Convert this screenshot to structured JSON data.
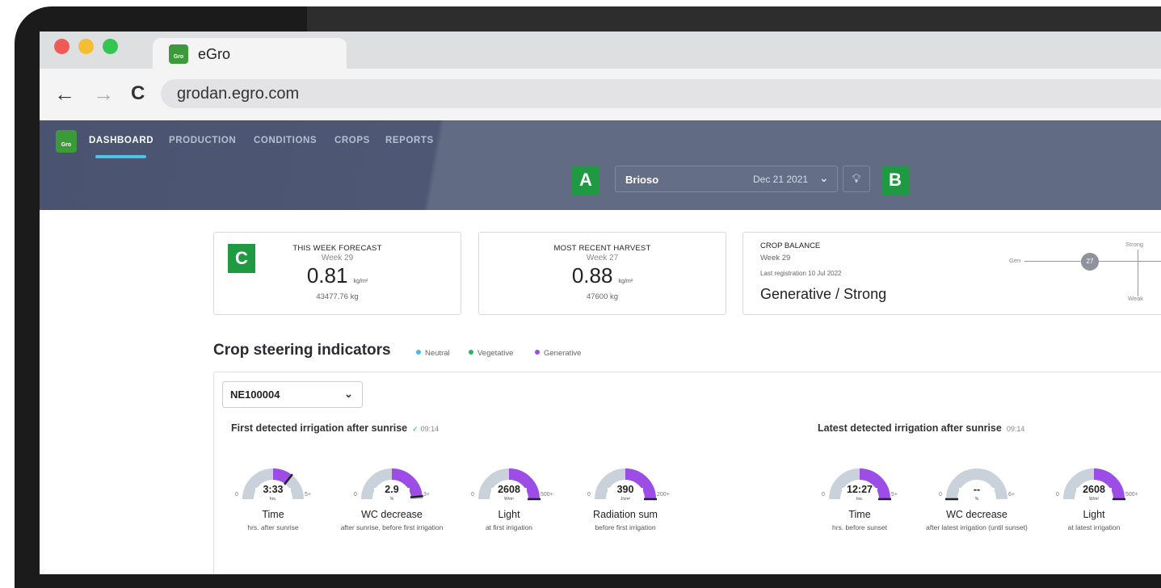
{
  "browser": {
    "tab_title": "eGro",
    "url": "grodan.egro.com",
    "back_glyph": "←",
    "forward_glyph": "→",
    "reload_glyph": "C",
    "favicon_text": "Gro",
    "dot_colors": [
      "#ee5b55",
      "#f5bd32",
      "#35c552"
    ]
  },
  "app": {
    "logo_text": "Gro",
    "nav": [
      "DASHBOARD",
      "PRODUCTION",
      "CONDITIONS",
      "CROPS",
      "REPORTS"
    ],
    "active_nav": "DASHBOARD",
    "location": "Brioso",
    "date": "Dec 21 2021",
    "markers": {
      "a": "A",
      "b": "B",
      "c": "C"
    },
    "accent": "#4cc3ea"
  },
  "cards": {
    "forecast": {
      "caption": "THIS WEEK FORECAST",
      "week": "Week 29",
      "value": "0.81",
      "unit": "kg/m²",
      "total": "43477.76 kg"
    },
    "harvest": {
      "caption": "MOST RECENT HARVEST",
      "week": "Week 27",
      "value": "0.88",
      "unit": "kg/m²",
      "total": "47600 kg"
    },
    "balance": {
      "caption": "CROP BALANCE",
      "week": "Week 29",
      "last": "Last registration 10 Jul 2022",
      "status": "Generative / Strong",
      "badge": "27",
      "axis_gen": "Gen",
      "axis_strong": "Strong",
      "axis_weak": "Weak"
    }
  },
  "steering": {
    "title": "Crop steering indicators",
    "legend": [
      {
        "label": "Neutral",
        "color": "#4cb8e8"
      },
      {
        "label": "Vegetative",
        "color": "#2db35d"
      },
      {
        "label": "Generative",
        "color": "#9b4de6"
      }
    ],
    "sensor": "NE100004",
    "first": {
      "title": "First detected irrigation after sunrise",
      "check": "✓",
      "time": "09:14",
      "gauges": [
        {
          "value": "3:33",
          "unit": "hrs.",
          "min": "0",
          "max": "5+",
          "label": "Time",
          "desc": "hrs. after sunrise",
          "fill": 0.71
        },
        {
          "value": "2.9",
          "unit": "%",
          "min": "0",
          "max": "3+",
          "label": "WC decrease",
          "desc": "after sunrise, before first irrigation",
          "fill": 0.97
        },
        {
          "value": "2608",
          "unit": "W/m²",
          "min": "0",
          "max": "500+",
          "label": "Light",
          "desc": "at first irrigation",
          "fill": 1.0
        },
        {
          "value": "390",
          "unit": "J/cm²",
          "min": "0",
          "max": "200+",
          "label": "Radiation sum",
          "desc": "before first irrigation",
          "fill": 1.0
        }
      ]
    },
    "latest": {
      "title": "Latest detected irrigation after sunrise",
      "time": "09:14",
      "gauges": [
        {
          "value": "12:27",
          "unit": "hrs.",
          "min": "0",
          "max": "5+",
          "label": "Time",
          "desc": "hrs. before sunset",
          "fill": 1.0
        },
        {
          "value": "--",
          "unit": "%",
          "min": "0",
          "max": "6+",
          "label": "WC decrease",
          "desc": "after latest irrigation (until sunset)",
          "fill": 0.0
        },
        {
          "value": "2608",
          "unit": "W/m²",
          "min": "0",
          "max": "500+",
          "label": "Light",
          "desc": "at latest irrigation",
          "fill": 1.0
        }
      ]
    }
  }
}
